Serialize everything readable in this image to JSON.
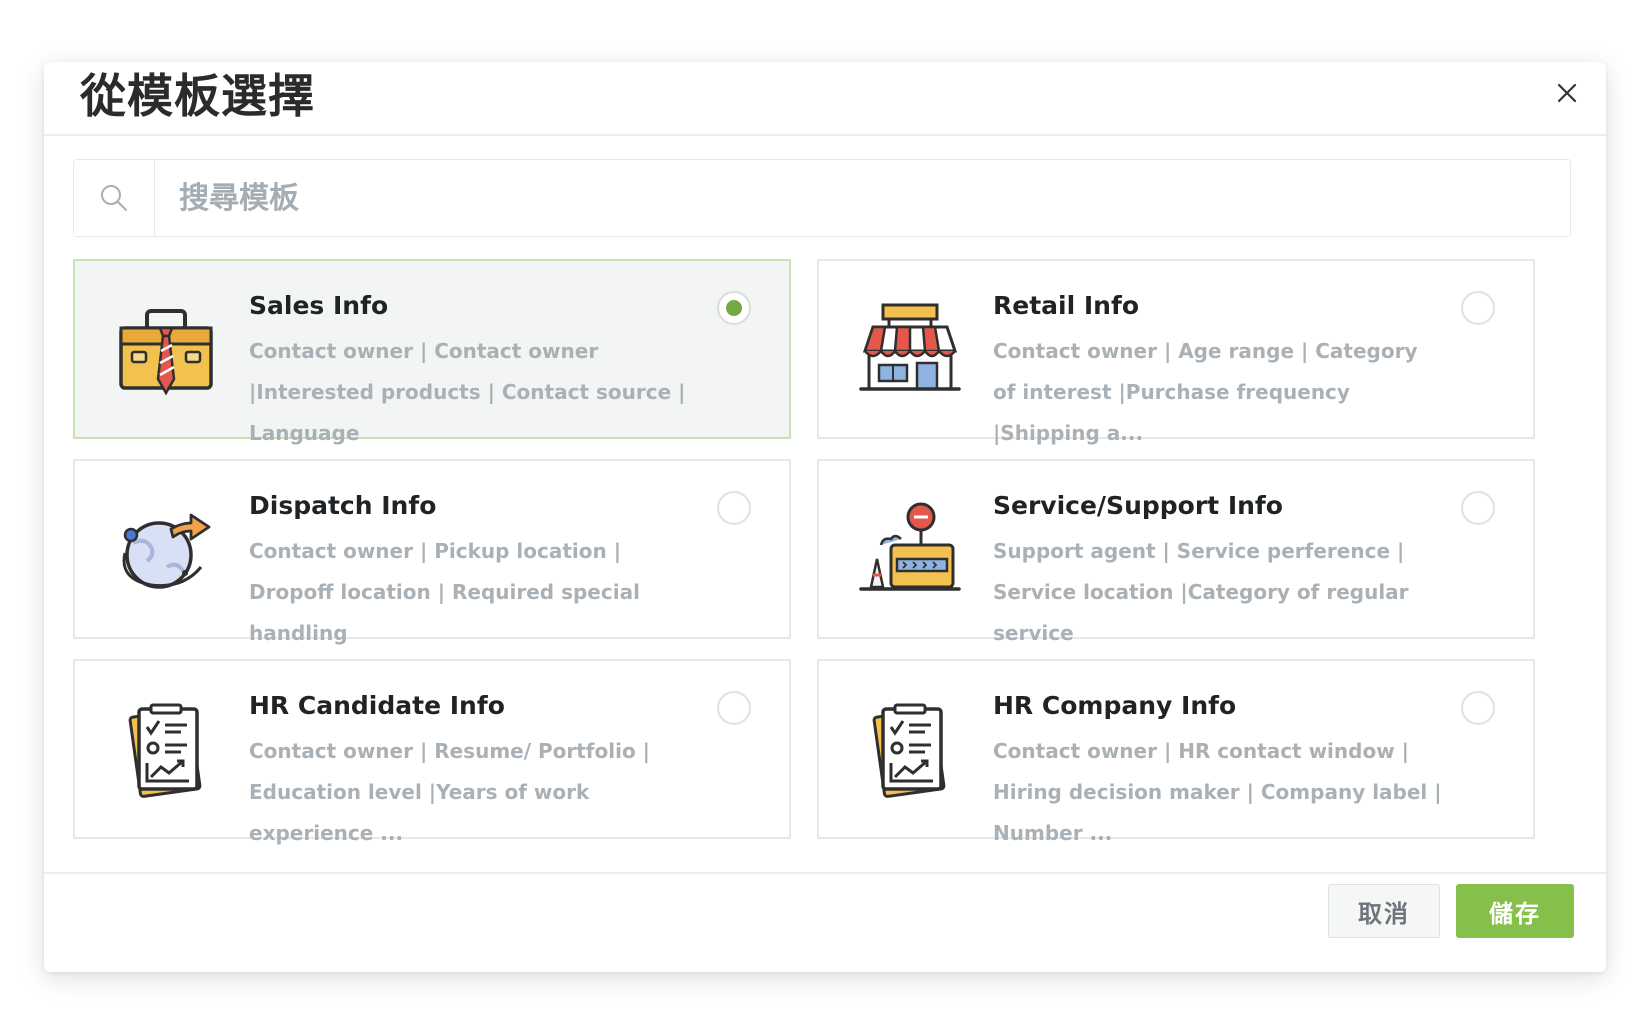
{
  "dialog": {
    "title": "從模板選擇",
    "close_icon": "close-icon"
  },
  "search": {
    "placeholder": "搜尋模板",
    "value": ""
  },
  "templates": [
    {
      "title": "Sales Info",
      "description": "Contact owner | Contact owner |Interested products | Contact source | Language",
      "icon": "briefcase-icon",
      "selected": true
    },
    {
      "title": "Retail Info",
      "description": "Contact owner | Age range | Category of interest |Purchase frequency |Shipping a...",
      "icon": "storefront-icon",
      "selected": false
    },
    {
      "title": "Dispatch Info",
      "description": "Contact owner | Pickup location | Dropoff location | Required special handling",
      "icon": "globe-arrow-icon",
      "selected": false
    },
    {
      "title": "Service/Support Info",
      "description": "Support agent | Service perference | Service location |Category of regular service",
      "icon": "service-counter-icon",
      "selected": false
    },
    {
      "title": "HR Candidate Info",
      "description": "Contact owner | Resume/ Portfolio | Education level |Years of work experience ...",
      "icon": "checklist-icon",
      "selected": false
    },
    {
      "title": "HR Company Info",
      "description": "Contact owner | HR contact window | Hiring decision maker | Company label | Number ...",
      "icon": "checklist-icon",
      "selected": false
    }
  ],
  "footer": {
    "cancel_label": "取消",
    "save_label": "儲存"
  },
  "colors": {
    "accent": "#86bf4a",
    "radio_selected": "#73a843",
    "card_selected_border": "#c9e2b4",
    "description_text": "#aab1b6"
  }
}
